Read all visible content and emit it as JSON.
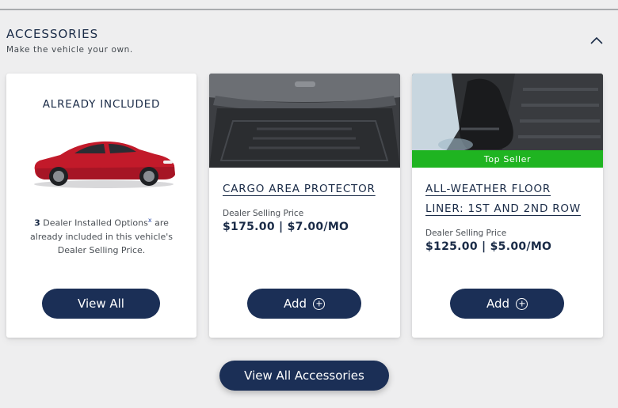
{
  "section": {
    "title": "ACCESSORIES",
    "subtitle": "Make the vehicle your own."
  },
  "included_card": {
    "heading": "ALREADY INCLUDED",
    "count": "3",
    "text_before_sup": " Dealer Installed Options",
    "sup": "x",
    "text_after_sup": " are already included in this vehicle's Dealer Selling Price.",
    "button_label": "View All"
  },
  "products": [
    {
      "name": "CARGO AREA PROTECTOR",
      "badge": "",
      "price_label": "Dealer Selling Price",
      "price": "$175.00 | $7.00/MO",
      "button_label": "Add"
    },
    {
      "name": "ALL-WEATHER FLOOR LINER: 1ST AND 2ND ROW",
      "badge": "Top Seller",
      "price_label": "Dealer Selling Price",
      "price": "$125.00 | $5.00/MO",
      "button_label": "Add"
    }
  ],
  "footer": {
    "button_label": "View All Accessories"
  },
  "colors": {
    "navy": "#1b2f56",
    "badge_green": "#1fb421",
    "page_bg": "#eeeeef",
    "car_red": "#c21a2a"
  },
  "icons": [
    "chevron-up-icon",
    "plus-circle-icon"
  ]
}
